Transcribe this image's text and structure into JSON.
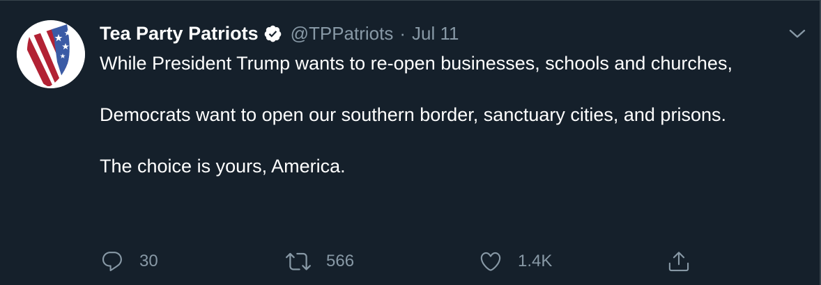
{
  "colors": {
    "background": "#15202b",
    "primary_text": "#ffffff",
    "secondary_text": "#8899a6",
    "border": "#38444d",
    "verified_badge": "#ffffff"
  },
  "tweet": {
    "author": {
      "display_name": "Tea Party Patriots",
      "verified": true,
      "handle": "@TPPatriots",
      "avatar_icon": "shield-flag-logo"
    },
    "separator": "·",
    "date": "Jul 11",
    "menu_icon": "chevron-down-icon",
    "paragraphs": [
      "While President Trump wants to re-open businesses, schools and churches,",
      "Democrats want to open our southern border, sanctuary cities, and prisons.",
      "The choice is yours, America."
    ],
    "actions": {
      "reply": {
        "icon": "reply-icon",
        "count": "30"
      },
      "retweet": {
        "icon": "retweet-icon",
        "count": "566"
      },
      "like": {
        "icon": "heart-icon",
        "count": "1.4K"
      },
      "share": {
        "icon": "share-icon"
      }
    }
  }
}
